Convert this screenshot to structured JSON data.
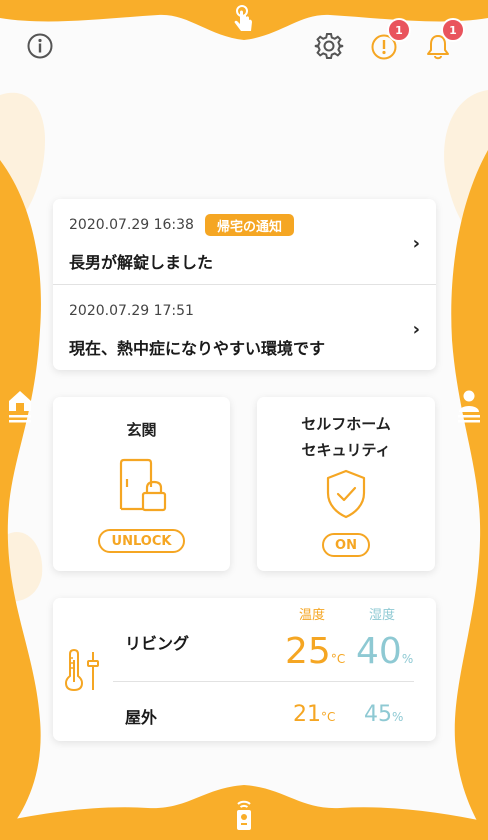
{
  "colors": {
    "accent": "#f5a623",
    "humidity": "#8ec9d3",
    "badge": "#e9545d"
  },
  "header": {
    "top_tab_icon": "tap-hand-icon",
    "info_icon": "info-icon",
    "settings_icon": "gear-icon",
    "alert_icon": "alert-icon",
    "alert_badge": "1",
    "bell_icon": "bell-icon",
    "bell_badge": "1"
  },
  "side_tabs": {
    "left_icon": "home-icon",
    "right_icon": "person-icon"
  },
  "bottom_tab_icon": "remote-control-icon",
  "notifications": [
    {
      "date": "2020.07.29 16:38",
      "tag": "帰宅の通知",
      "text": "長男が解錠しました"
    },
    {
      "date": "2020.07.29 17:51",
      "tag": "",
      "text": "現在、熱中症になりやすい環境です"
    }
  ],
  "tiles": {
    "door": {
      "title": "玄関",
      "status": "UNLOCK",
      "icon": "door-lock-icon"
    },
    "security": {
      "title_line1": "セルフホーム",
      "title_line2": "セキュリティ",
      "status": "ON",
      "icon": "shield-check-icon"
    }
  },
  "climate": {
    "icon": "thermometer-icon",
    "temp_header": "温度",
    "humidity_header": "湿度",
    "rows": [
      {
        "room": "リビング",
        "temp": "25",
        "temp_unit": "°C",
        "humidity": "40",
        "humidity_unit": "%"
      },
      {
        "room": "屋外",
        "temp": "21",
        "temp_unit": "°C",
        "humidity": "45",
        "humidity_unit": "%"
      }
    ]
  }
}
